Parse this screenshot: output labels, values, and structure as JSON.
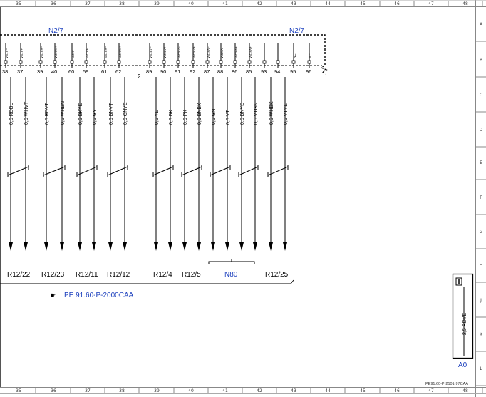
{
  "column_numbers": [
    "35",
    "36",
    "37",
    "38",
    "39",
    "40",
    "41",
    "42",
    "43",
    "44",
    "45",
    "46",
    "47",
    "48"
  ],
  "row_letters": [
    "A",
    "B",
    "C",
    "D",
    "E",
    "F",
    "G",
    "H",
    "J",
    "K",
    "L"
  ],
  "connector_labels": {
    "left": "N2/7",
    "right": "N2/7"
  },
  "splice_mark": "2",
  "pins": [
    {
      "num": "38",
      "sig": "VB1V−"
    },
    {
      "num": "37",
      "sig": "VB1V+"
    },
    {
      "num": "39",
      "sig": "VB1VR−"
    },
    {
      "num": "40",
      "sig": "VB1VR+"
    },
    {
      "num": "60",
      "sig": "SB1V−"
    },
    {
      "num": "59",
      "sig": "SB1V+"
    },
    {
      "num": "61",
      "sig": "SB1VR−"
    },
    {
      "num": "62",
      "sig": "SB1VR+"
    },
    {
      "num": "89",
      "sig": "VB1B7−"
    },
    {
      "num": "90",
      "sig": "VB1B7+"
    },
    {
      "num": "91",
      "sig": "VB2B7−"
    },
    {
      "num": "92",
      "sig": "VB2B7+"
    },
    {
      "num": "87",
      "sig": "VB1FA−"
    },
    {
      "num": "88",
      "sig": "VB2FA−"
    },
    {
      "num": "86",
      "sig": "VB2FA+"
    },
    {
      "num": "85",
      "sig": "VB1FA+"
    },
    {
      "num": "93",
      "sig": ""
    },
    {
      "num": "94",
      "sig": ""
    },
    {
      "num": "95",
      "sig": "NC"
    },
    {
      "num": "96",
      "sig": "NC"
    }
  ],
  "wires": [
    "0,5 RDBU",
    "0,5 WHVT",
    "0,5 RDVT",
    "0,5 WHBN",
    "0,5 BKYE",
    "0,5 GY",
    "0,5 BNVT",
    "0,5 GNYE",
    "0,5 YE",
    "0,5 BK",
    "0,5 PK",
    "0,5 BNBK",
    "0,5 GN",
    "0,5 VT",
    "0,5 BNYE",
    "0,5 VTGN",
    "0,5 WHBK",
    "0,5 VTYE"
  ],
  "destinations": {
    "r1": "R12/22",
    "r2": "R12/23",
    "r3": "R12/11",
    "r4": "R12/12",
    "r5": "R12/4",
    "r6": "R12/5",
    "r7": "N80",
    "r8": "R12/25"
  },
  "page_reference": "PE 91.60-P-2000CAA",
  "ground_box": {
    "wire": "2,5 RDYE",
    "id": "A0"
  },
  "sheet_id": "PE91.60-P-2101-97CAA",
  "colors": {
    "accent_blue": "#1b3fbd",
    "line": "#000000",
    "grid": "#666666"
  }
}
